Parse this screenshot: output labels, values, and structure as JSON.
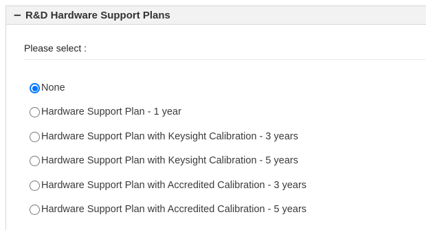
{
  "section": {
    "collapse_icon": "minus-icon",
    "title": "R&D Hardware Support Plans"
  },
  "prompt": "Please select :",
  "options": [
    {
      "label": "None",
      "selected": true
    },
    {
      "label": "Hardware Support Plan - 1 year",
      "selected": false
    },
    {
      "label": "Hardware Support Plan with Keysight Calibration - 3 years",
      "selected": false
    },
    {
      "label": "Hardware Support Plan with Keysight Calibration - 5 years",
      "selected": false
    },
    {
      "label": "Hardware Support Plan with Accredited Calibration - 3 years",
      "selected": false
    },
    {
      "label": "Hardware Support Plan with Accredited Calibration - 5 years",
      "selected": false
    }
  ],
  "colors": {
    "radio_selected": "#0075ff",
    "header_background": "#f2f2f2",
    "border": "#d6d6d6"
  }
}
